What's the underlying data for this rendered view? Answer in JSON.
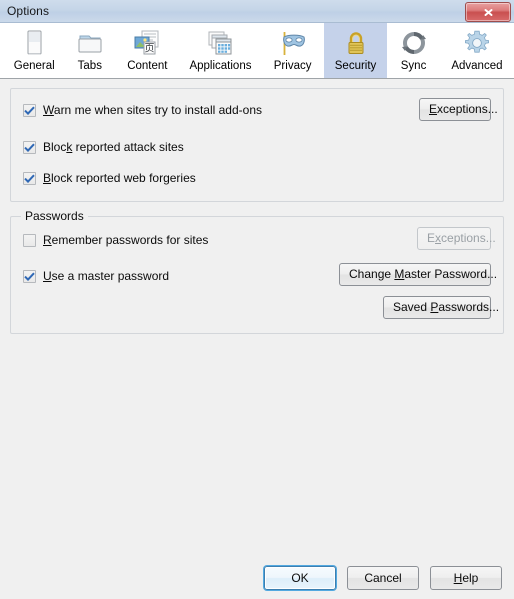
{
  "window": {
    "title": "Options",
    "close_icon": "close-x-icon"
  },
  "toolbar": {
    "tabs": [
      {
        "label": "General",
        "icon": "general-window-icon",
        "selected": false
      },
      {
        "label": "Tabs",
        "icon": "tabs-folder-icon",
        "selected": false
      },
      {
        "label": "Content",
        "icon": "content-page-icon",
        "selected": false
      },
      {
        "label": "Applications",
        "icon": "applications-windows-icon",
        "selected": false
      },
      {
        "label": "Privacy",
        "icon": "privacy-mask-icon",
        "selected": false
      },
      {
        "label": "Security",
        "icon": "security-padlock-icon",
        "selected": true
      },
      {
        "label": "Sync",
        "icon": "sync-arrows-icon",
        "selected": false
      },
      {
        "label": "Advanced",
        "icon": "advanced-gear-icon",
        "selected": false
      }
    ]
  },
  "security_panel": {
    "options": [
      {
        "label_pre": "",
        "label_accel": "W",
        "label_post": "arn me when sites try to install add-ons",
        "checked": true
      },
      {
        "label_pre": "Bloc",
        "label_accel": "k",
        "label_post": " reported attack sites",
        "checked": true
      },
      {
        "label_pre": "",
        "label_accel": "B",
        "label_post": "lock reported web forgeries",
        "checked": true
      }
    ],
    "exceptions_button": {
      "pre": "",
      "accel": "E",
      "post": "xceptions...",
      "enabled": true
    }
  },
  "passwords_group": {
    "legend": "Passwords",
    "options": [
      {
        "label_pre": "",
        "label_accel": "R",
        "label_post": "emember passwords for sites",
        "checked": false
      },
      {
        "label_pre": "",
        "label_accel": "U",
        "label_post": "se a master password",
        "checked": true
      }
    ],
    "exceptions_button": {
      "pre": "E",
      "accel": "x",
      "post": "ceptions...",
      "enabled": false
    },
    "change_master_button": {
      "pre": "Change ",
      "accel": "M",
      "post": "aster Password..."
    },
    "saved_passwords_button": {
      "pre": "Saved ",
      "accel": "P",
      "post": "asswords..."
    }
  },
  "footer": {
    "ok": {
      "pre": "OK",
      "accel": "",
      "post": ""
    },
    "cancel": {
      "pre": "Cancel",
      "accel": "",
      "post": ""
    },
    "help": {
      "pre": "",
      "accel": "H",
      "post": "elp"
    }
  },
  "colors": {
    "titlebar": "#c5d5e8",
    "selected_tab": "#c5d2ea",
    "background": "#f0f0f0",
    "close_button": "#c95050",
    "check_blue": "#2f68b5",
    "focus_blue": "#53a9e0"
  }
}
